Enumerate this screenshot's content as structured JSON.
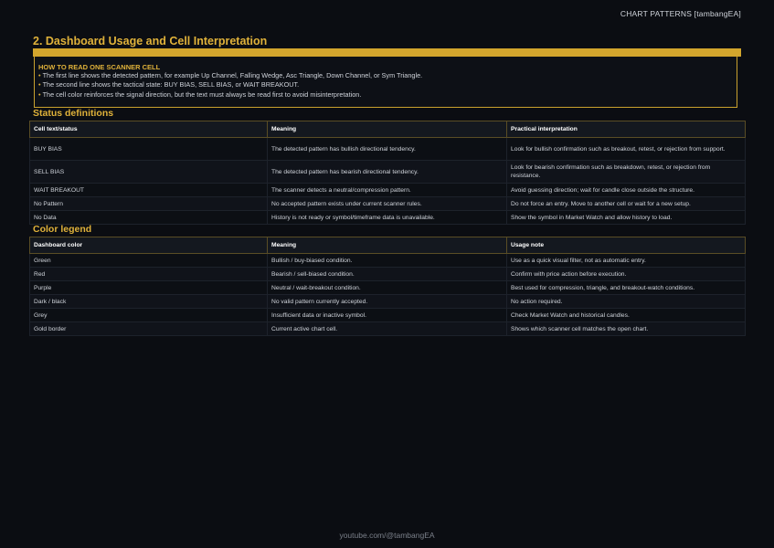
{
  "header": {
    "doc_title": "CHART PATTERNS [tambangEA]"
  },
  "section": {
    "title": "2. Dashboard Usage and Cell Interpretation"
  },
  "callout": {
    "title": "HOW TO READ ONE SCANNER CELL",
    "bullet": "•",
    "lines": [
      "The first line shows the detected pattern, for example Up Channel, Falling Wedge, Asc Triangle, Down Channel, or Sym Triangle.",
      "The second line shows the tactical state: BUY BIAS, SELL BIAS, or WAIT BREAKOUT.",
      "The cell color reinforces the signal direction, but the text must always be read first to avoid misinterpretation."
    ]
  },
  "status_table": {
    "heading": "Status definitions",
    "columns": [
      "Cell text/status",
      "Meaning",
      "Practical interpretation"
    ],
    "rows": [
      [
        "BUY BIAS",
        "The detected pattern has bullish directional tendency.",
        "Look for bullish confirmation such as breakout, retest, or rejection from support."
      ],
      [
        "SELL BIAS",
        "The detected pattern has bearish directional tendency.",
        "Look for bearish confirmation such as breakdown, retest, or rejection from resistance."
      ],
      [
        "WAIT BREAKOUT",
        "The scanner detects a neutral/compression pattern.",
        "Avoid guessing direction; wait for candle close outside the structure."
      ],
      [
        "No Pattern",
        "No accepted pattern exists under current scanner rules.",
        "Do not force an entry. Move to another cell or wait for a new setup."
      ],
      [
        "No Data",
        "History is not ready or symbol/timeframe data is unavailable.",
        "Show the symbol in Market Watch and allow history to load."
      ]
    ]
  },
  "color_table": {
    "heading": "Color legend",
    "columns": [
      "Dashboard color",
      "Meaning",
      "Usage note"
    ],
    "rows": [
      [
        "Green",
        "Bullish / buy-biased condition.",
        "Use as a quick visual filter, not as automatic entry."
      ],
      [
        "Red",
        "Bearish / sell-biased condition.",
        "Confirm with price action before execution."
      ],
      [
        "Purple",
        "Neutral / wait-breakout condition.",
        "Best used for compression, triangle, and breakout-watch conditions."
      ],
      [
        "Dark / black",
        "No valid pattern currently accepted.",
        "No action required."
      ],
      [
        "Grey",
        "Insufficient data or inactive symbol.",
        "Check Market Watch and historical candles."
      ],
      [
        "Gold border",
        "Current active chart cell.",
        "Shows which scanner cell matches the open chart."
      ]
    ]
  },
  "footer": {
    "text": "youtube.com/@tambangEA"
  },
  "colors": {
    "accent_gold": "#e0b23a",
    "background": "#0b0d12"
  }
}
